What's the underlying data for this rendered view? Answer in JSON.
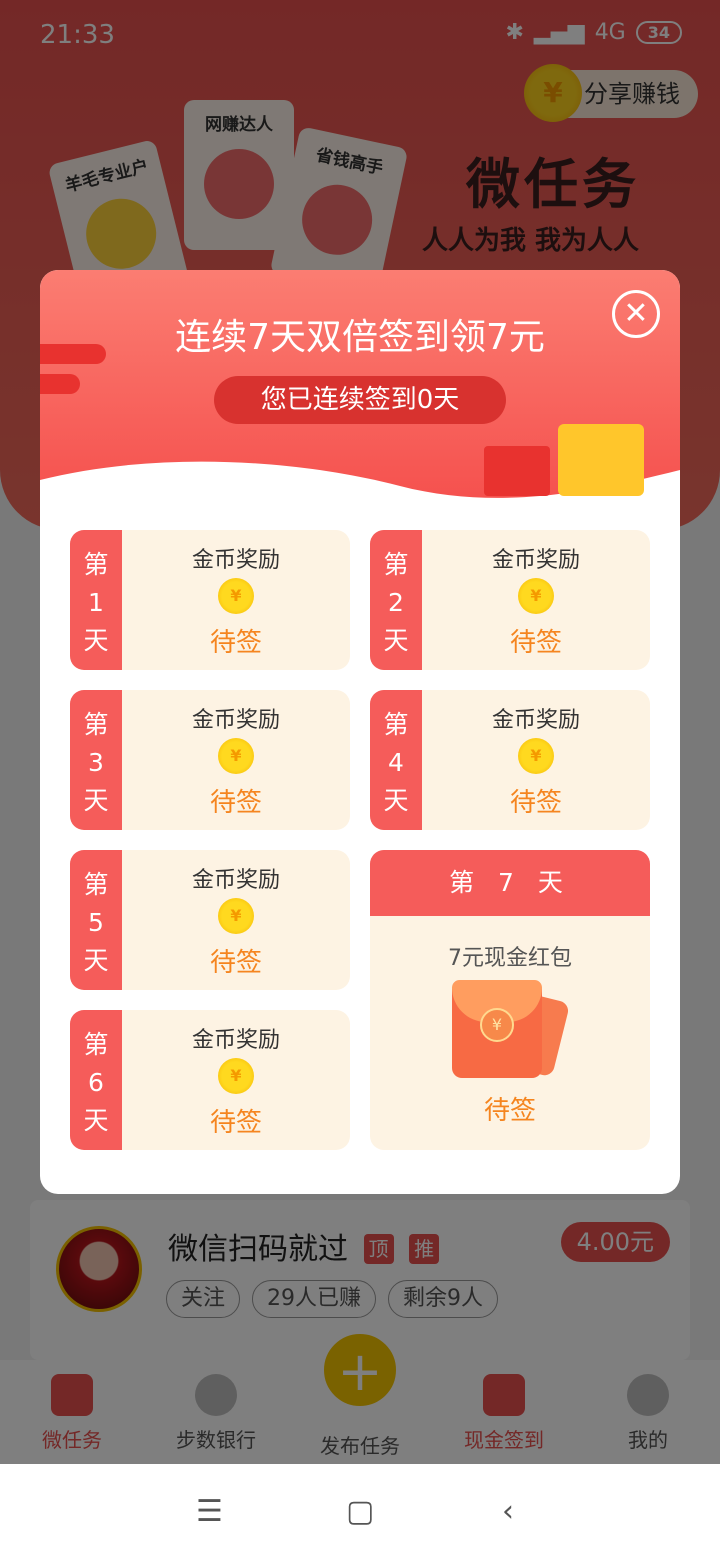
{
  "status_bar": {
    "time": "21:33",
    "network": "4G",
    "battery": "34"
  },
  "header": {
    "share_button": "分享赚钱",
    "app_title": "微任务",
    "slogan": "人人为我 我为人人",
    "tags": [
      "羊毛专业户",
      "网赚达人",
      "省钱高手"
    ]
  },
  "modal": {
    "title": "连续7天双倍签到领7元",
    "streak_text": "您已连续签到0天",
    "close_icon": "close-icon",
    "days": [
      {
        "strip": [
          "第",
          "1",
          "天"
        ],
        "label": "金币奖励",
        "status": "待签"
      },
      {
        "strip": [
          "第",
          "2",
          "天"
        ],
        "label": "金币奖励",
        "status": "待签"
      },
      {
        "strip": [
          "第",
          "3",
          "天"
        ],
        "label": "金币奖励",
        "status": "待签"
      },
      {
        "strip": [
          "第",
          "4",
          "天"
        ],
        "label": "金币奖励",
        "status": "待签"
      },
      {
        "strip": [
          "第",
          "5",
          "天"
        ],
        "label": "金币奖励",
        "status": "待签"
      },
      {
        "strip": [
          "第",
          "6",
          "天"
        ],
        "label": "金币奖励",
        "status": "待签"
      }
    ],
    "day7": {
      "header": "第 7 天",
      "label": "7元现金红包",
      "status": "待签"
    },
    "coin_symbol": "¥"
  },
  "task": {
    "title": "微信扫码就过",
    "tags": [
      "顶",
      "推"
    ],
    "price": "4.00元",
    "chips": [
      "关注",
      "29人已赚",
      "剩余9人"
    ]
  },
  "tabbar": {
    "tabs": [
      {
        "label": "微任务",
        "icon": "task-icon"
      },
      {
        "label": "步数银行",
        "icon": "runner-icon"
      },
      {
        "label": "发布任务",
        "icon": "plus-icon"
      },
      {
        "label": "现金签到",
        "icon": "red-packet-icon"
      },
      {
        "label": "我的",
        "icon": "user-icon"
      }
    ]
  },
  "colors": {
    "primary": "#f55c5a",
    "accent": "#f5851f",
    "gold": "#ffd21c"
  }
}
